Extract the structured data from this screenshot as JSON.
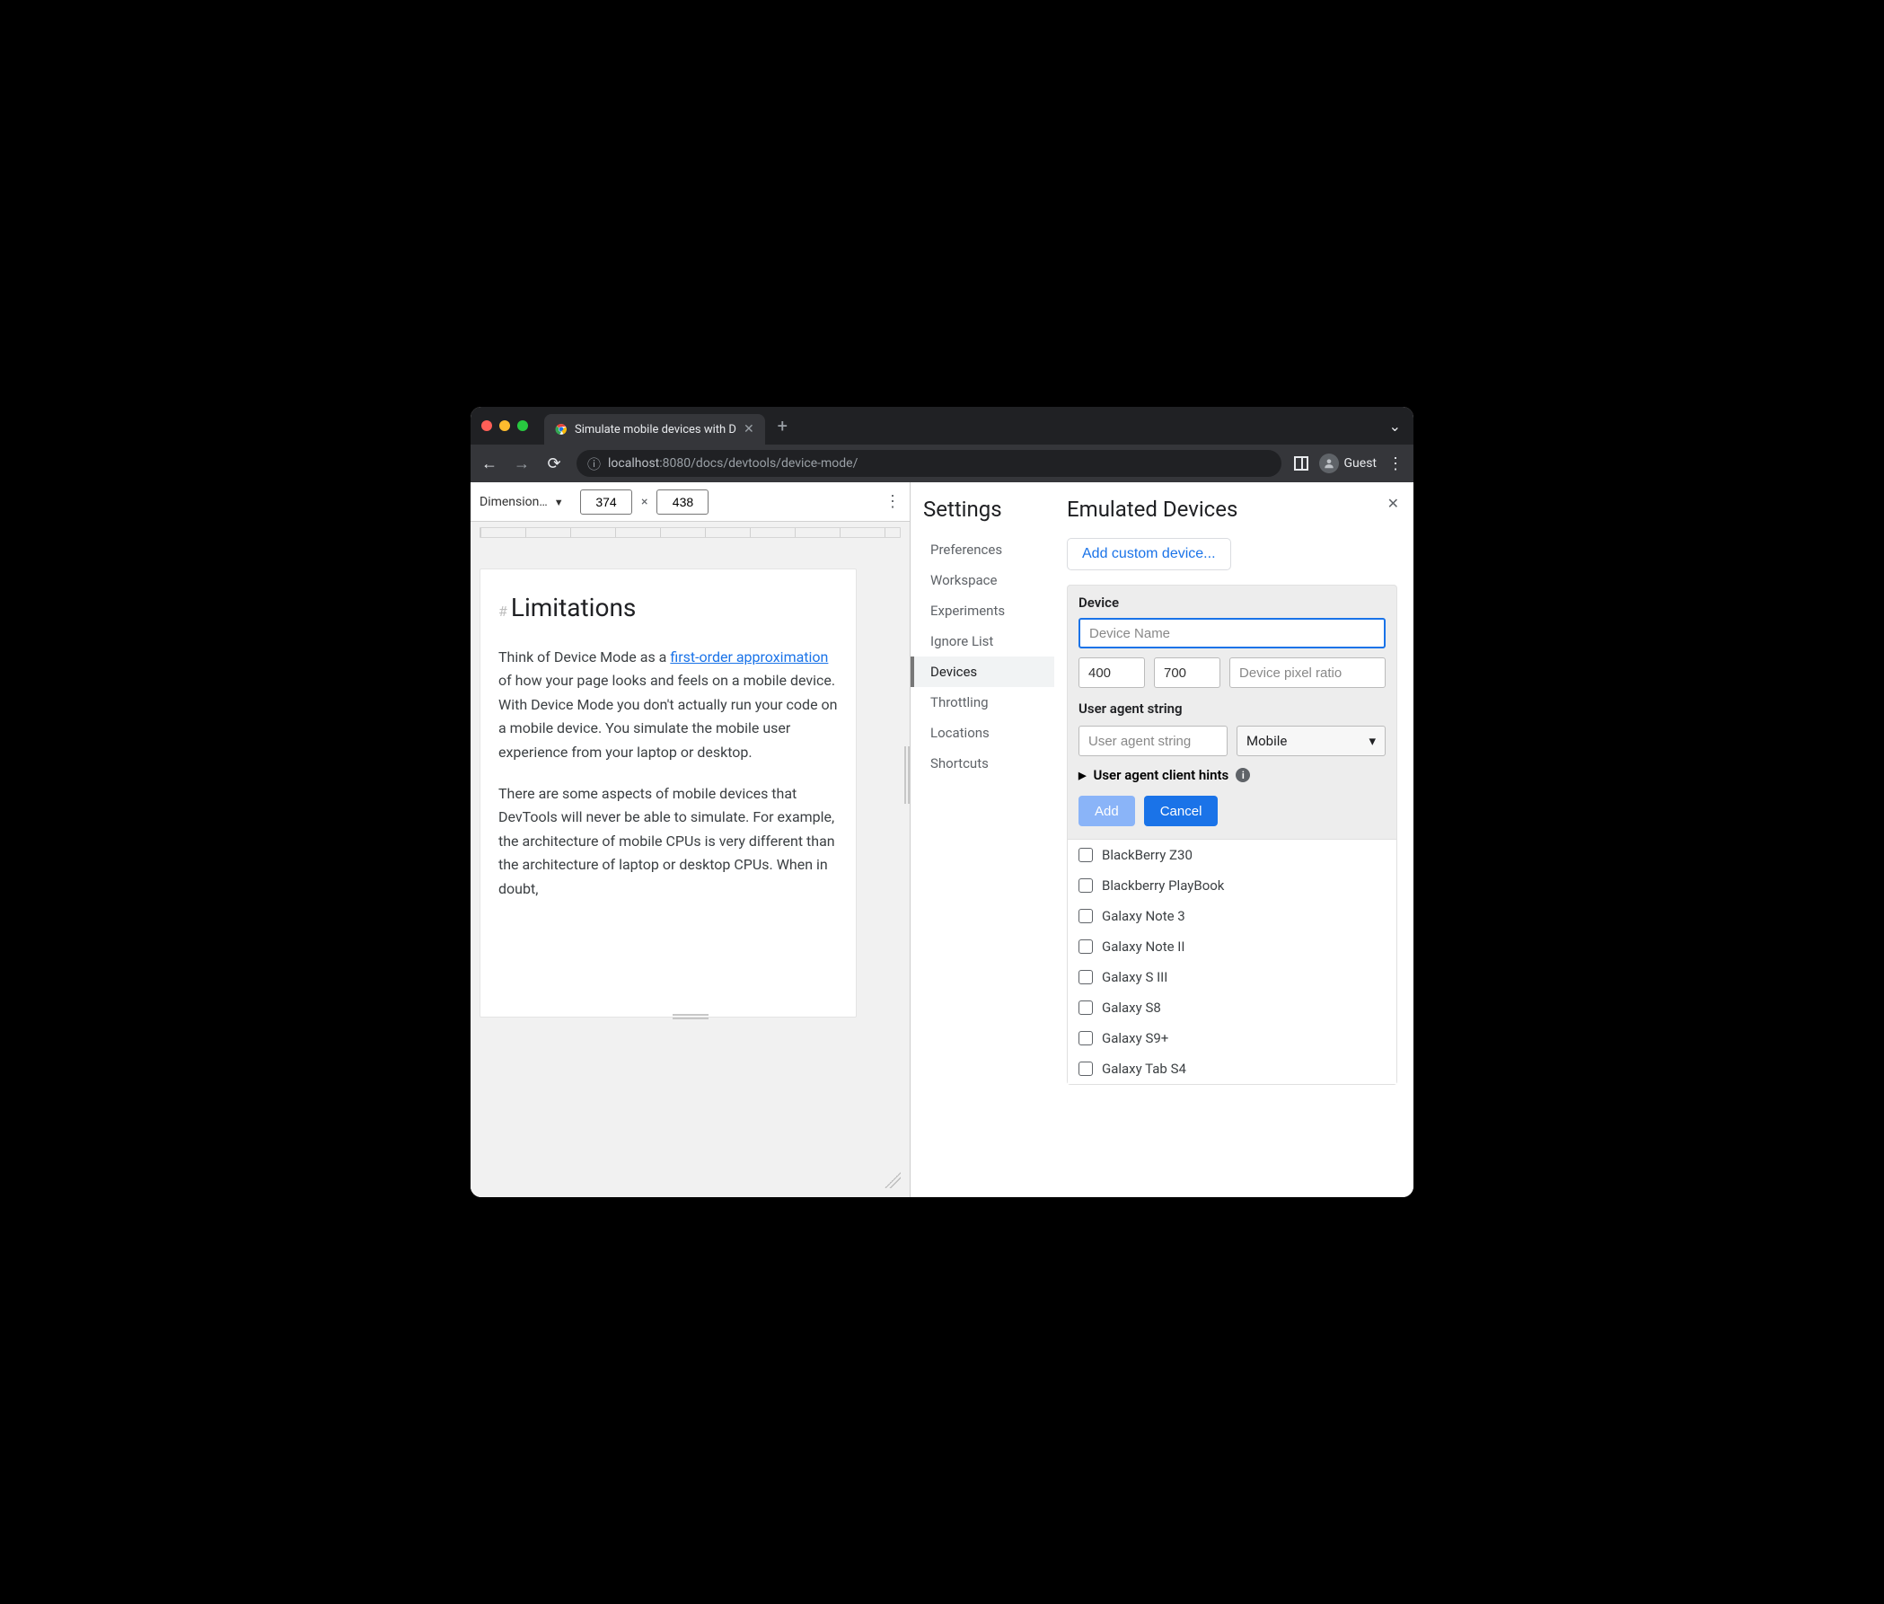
{
  "window": {
    "tab_title": "Simulate mobile devices with D",
    "guest_label": "Guest"
  },
  "addressbar": {
    "host": "localhost",
    "port": ":8080",
    "path": "/docs/devtools/device-mode/"
  },
  "device_toolbar": {
    "dimensions_label": "Dimension…",
    "width": "374",
    "separator": "×",
    "height": "438"
  },
  "page": {
    "heading": "Limitations",
    "p1_a": "Think of Device Mode as a ",
    "p1_link": "first-order approximation",
    "p1_b": " of how your page looks and feels on a mobile device. With Device Mode you don't actually run your code on a mobile device. You simulate the mobile user experience from your laptop or desktop.",
    "p2": "There are some aspects of mobile devices that DevTools will never be able to simulate. For example, the architecture of mobile CPUs is very different than the architecture of laptop or desktop CPUs. When in doubt,"
  },
  "settings": {
    "title": "Settings",
    "items": [
      "Preferences",
      "Workspace",
      "Experiments",
      "Ignore List",
      "Devices",
      "Throttling",
      "Locations",
      "Shortcuts"
    ],
    "active_index": 4
  },
  "emulated": {
    "title": "Emulated Devices",
    "add_custom": "Add custom device...",
    "device_section": "Device",
    "name_placeholder": "Device Name",
    "width": "400",
    "height": "700",
    "dpr_placeholder": "Device pixel ratio",
    "ua_section": "User agent string",
    "ua_placeholder": "User agent string",
    "ua_type": "Mobile",
    "hints_label": "User agent client hints",
    "btn_add": "Add",
    "btn_cancel": "Cancel",
    "devices": [
      "BlackBerry Z30",
      "Blackberry PlayBook",
      "Galaxy Note 3",
      "Galaxy Note II",
      "Galaxy S III",
      "Galaxy S8",
      "Galaxy S9+",
      "Galaxy Tab S4"
    ]
  }
}
